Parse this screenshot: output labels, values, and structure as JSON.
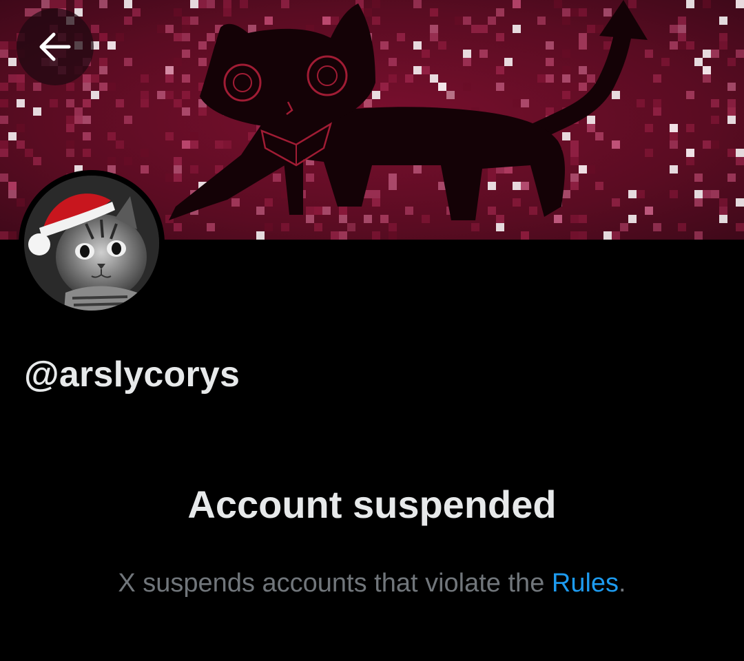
{
  "header": {
    "back_icon": "arrow-left-icon",
    "banner_image": "pixelated crimson banner with black devil-tailed cat drawing"
  },
  "profile": {
    "avatar_image": "grayscale kitten wearing a red Santa hat",
    "handle": "@arslycorys"
  },
  "notice": {
    "title": "Account suspended",
    "description_prefix": "X suspends accounts that violate the ",
    "rules_link_label": "Rules",
    "description_suffix": "."
  },
  "colors": {
    "background": "#000000",
    "primary_text": "#e7e9ea",
    "secondary_text": "#71767b",
    "link": "#1d9bf0",
    "banner_base": "#4a0b1d"
  }
}
